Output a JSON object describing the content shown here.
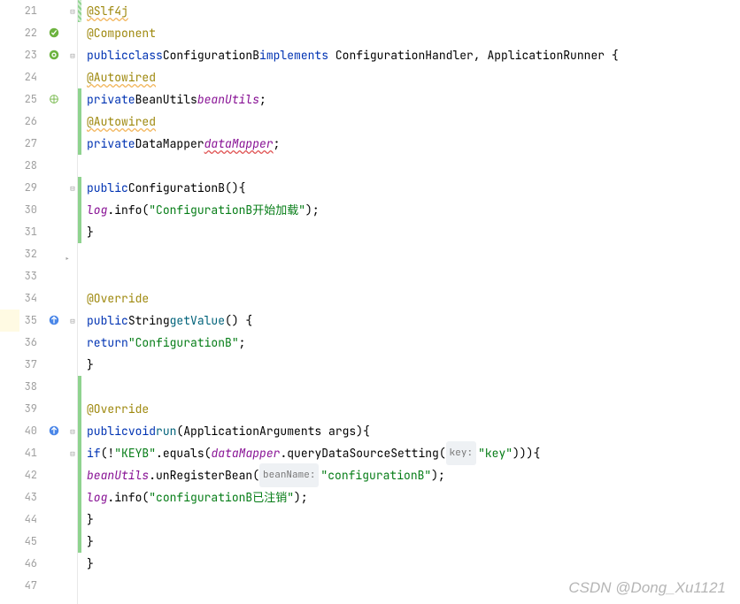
{
  "lines": {
    "start": 21,
    "end": 47,
    "nums": [
      "21",
      "22",
      "23",
      "24",
      "25",
      "26",
      "27",
      "28",
      "29",
      "30",
      "31",
      "32",
      "33",
      "34",
      "35",
      "36",
      "37",
      "38",
      "39",
      "40",
      "41",
      "42",
      "43",
      "44",
      "45",
      "46",
      "47"
    ]
  },
  "code": {
    "l21": {
      "ann": "@Slf4j"
    },
    "l22": {
      "ann": "@Component"
    },
    "l23": {
      "kw1": "public",
      "kw2": "class",
      "cls": "ConfigurationB",
      "kw3": "implements",
      "t": " ConfigurationHandler, ApplicationRunner {"
    },
    "l24": {
      "ann": "@Autowired"
    },
    "l25": {
      "kw": "private",
      "cls": "BeanUtils",
      "fld": "beanUtils",
      "semi": ";"
    },
    "l26": {
      "ann": "@Autowired"
    },
    "l27": {
      "kw": "private",
      "cls": "DataMapper",
      "fld": "dataMapper",
      "semi": ";"
    },
    "l29": {
      "kw": "public",
      "ctor": "ConfigurationB",
      "t": "(){"
    },
    "l30": {
      "fld": "log",
      "mth": ".info",
      "p": "(",
      "str": "\"ConfigurationB开始加载\"",
      "e": ");"
    },
    "l31": {
      "t": "}"
    },
    "l34": {
      "ann": "@Override"
    },
    "l35": {
      "kw": "public",
      "type": "String",
      "mth": "getValue",
      "t": "() {"
    },
    "l36": {
      "kw": "return",
      "str": "\"ConfigurationB\"",
      "semi": ";"
    },
    "l37": {
      "t": "}"
    },
    "l39": {
      "ann": "@Override"
    },
    "l40": {
      "kw1": "public",
      "kw2": "void",
      "mth": "run",
      "t": "(ApplicationArguments args){"
    },
    "l41": {
      "kw": "if",
      "t1": "(!",
      "str1": "\"KEYB\"",
      "t2": ".equals(",
      "fld": "dataMapper",
      "t3": ".queryDataSourceSetting(",
      "hint": "key:",
      "str2": "\"key\"",
      "t4": "))){"
    },
    "l42": {
      "fld": "beanUtils",
      "t1": ".unRegisterBean(",
      "hint": "beanName:",
      "str": "\"configurationB\"",
      "t2": ");"
    },
    "l43": {
      "fld": "log",
      "mth": ".info",
      "p": "(",
      "str": "\"configurationB已注销\"",
      "e": ");"
    },
    "l44": {
      "t": "}"
    },
    "l45": {
      "t": "}"
    },
    "l46": {
      "t": "}"
    }
  },
  "watermark": "CSDN @Dong_Xu1121",
  "icons": {
    "component": "component-icon",
    "bean": "bean-icon",
    "override_up": "override-up-icon",
    "override_down": "override-down-icon"
  }
}
